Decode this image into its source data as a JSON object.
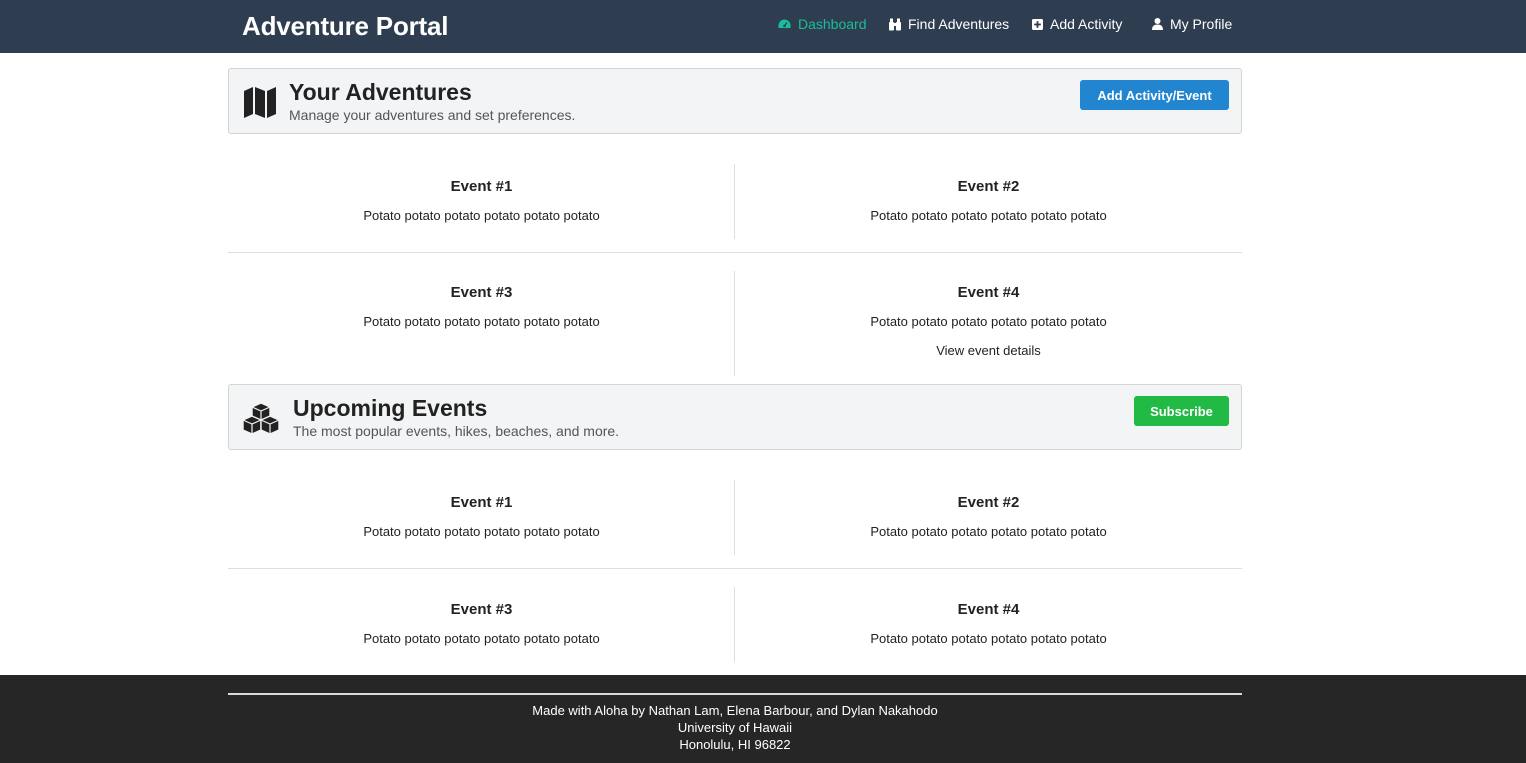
{
  "navbar": {
    "brand": "Adventure Portal",
    "items": [
      {
        "label": "Dashboard",
        "icon": "dashboard-icon",
        "active": true
      },
      {
        "label": "Find Adventures",
        "icon": "binoculars-icon",
        "active": false
      },
      {
        "label": "Add Activity",
        "icon": "plus-square-icon",
        "active": false
      },
      {
        "label": "My Profile",
        "icon": "user-icon",
        "active": false
      }
    ]
  },
  "your_adventures": {
    "icon": "map-icon",
    "title": "Your Adventures",
    "subtitle": "Manage your adventures and set preferences.",
    "button_label": "Add Activity/Event",
    "events": [
      {
        "title": "Event #1",
        "description": "Potato potato potato potato potato potato"
      },
      {
        "title": "Event #2",
        "description": "Potato potato potato potato potato potato"
      },
      {
        "title": "Event #3",
        "description": "Potato potato potato potato potato potato"
      },
      {
        "title": "Event #4",
        "description": "Potato potato potato potato potato potato",
        "link": "View event details"
      }
    ]
  },
  "upcoming_events": {
    "icon": "cubes-icon",
    "title": "Upcoming Events",
    "subtitle": "The most popular events, hikes, beaches, and more.",
    "button_label": "Subscribe",
    "events": [
      {
        "title": "Event #1",
        "description": "Potato potato potato potato potato potato"
      },
      {
        "title": "Event #2",
        "description": "Potato potato potato potato potato potato"
      },
      {
        "title": "Event #3",
        "description": "Potato potato potato potato potato potato"
      },
      {
        "title": "Event #4",
        "description": "Potato potato potato potato potato potato"
      }
    ]
  },
  "footer": {
    "line1": "Made with Aloha by Nathan Lam, Elena Barbour, and Dylan Nakahodo",
    "line2": "University of Hawaii",
    "line3": "Honolulu, HI 96822"
  },
  "colors": {
    "navbar_bg": "#2e3e50",
    "active_nav": "#1abc9c",
    "primary_button": "#2185d0",
    "success_button": "#21ba45",
    "footer_bg": "#262626"
  }
}
